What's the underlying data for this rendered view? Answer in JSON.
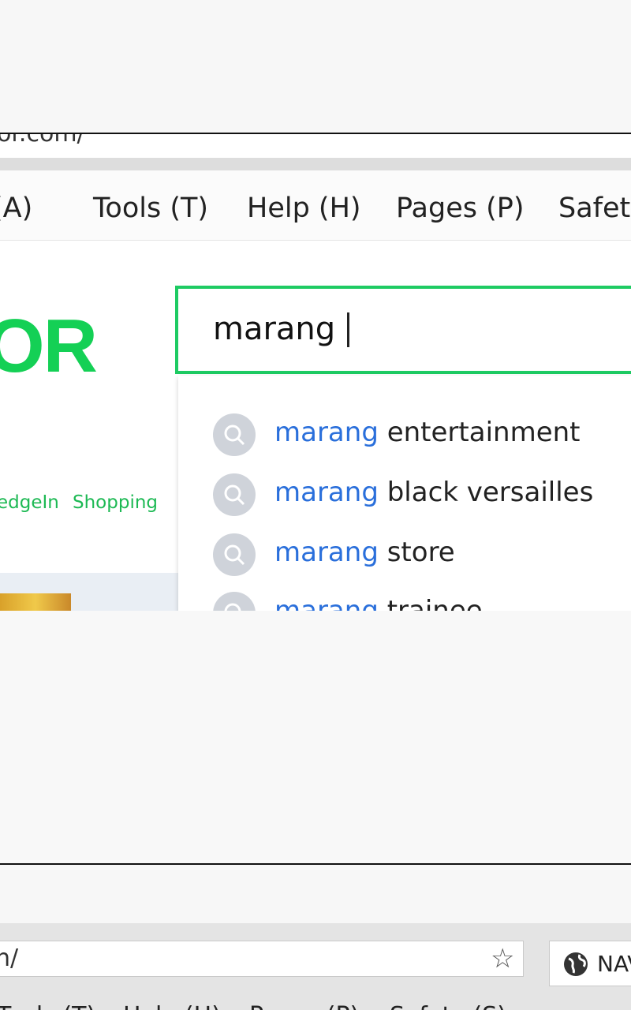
{
  "top": {
    "url_fragment": "or.com/",
    "menu": [
      "(A)",
      "Tools (T)",
      "Help (H)",
      "Pages (P)",
      "Safety"
    ],
    "logo_text": "OR",
    "nav_links": [
      "edgeIn",
      "Shopping"
    ],
    "search": {
      "value": "marang",
      "accent_color": "#1ecb63"
    },
    "suggestions": [
      {
        "query": "marang",
        "rest": "entertainment"
      },
      {
        "query": "marang",
        "rest": "black versailles"
      },
      {
        "query": "marang",
        "rest": "store"
      },
      {
        "query": "marang",
        "rest": "trainee"
      }
    ]
  },
  "bottom": {
    "url_fragment": "n/",
    "tab_label": "NAV",
    "menu": [
      "Tools (T)",
      "Help (H)",
      "Pages (P)",
      "Safety (S)"
    ]
  },
  "icons": {
    "search": "search-icon",
    "star": "star-icon",
    "globe": "globe-icon"
  }
}
